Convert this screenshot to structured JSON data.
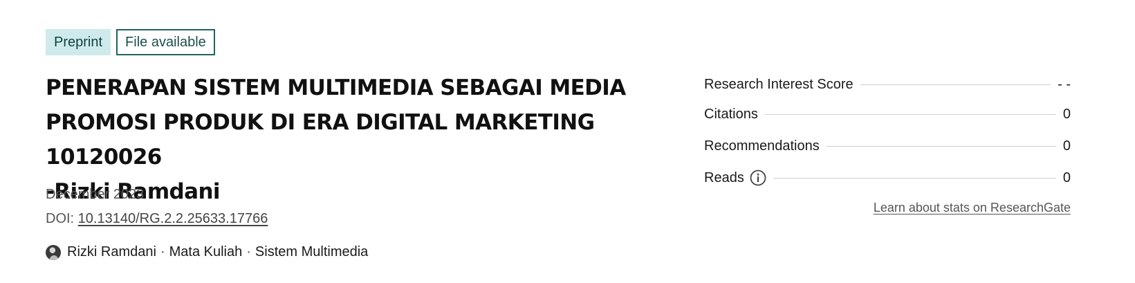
{
  "badges": {
    "preprint": "Preprint",
    "file_available": "File available"
  },
  "title_lines": [
    "PENERAPAN SISTEM MULTIMEDIA SEBAGAI MEDIA",
    "PROMOSI PRODUK DI ERA DIGITAL MARKETING 10120026",
    "-Rizki Ramdani"
  ],
  "date": "December 2023",
  "doi": {
    "label": "DOI: ",
    "value": "10.13140/RG.2.2.25633.17766"
  },
  "authors": {
    "author": "Rizki Ramdani",
    "separator": "·",
    "course": "Mata Kuliah",
    "subject": "Sistem Multimedia"
  },
  "stats": [
    {
      "label": "Research Interest Score",
      "value": "- -"
    },
    {
      "label": "Citations",
      "value": "0"
    },
    {
      "label": "Recommendations",
      "value": "0"
    },
    {
      "label": "Reads",
      "value": "0"
    }
  ],
  "learn_link": "Learn about stats on ResearchGate",
  "colors": {
    "preprint_bg": "#cfeaea",
    "file_border": "#1d6461"
  },
  "icons": {
    "reads_info": "info-icon",
    "avatar": "avatar"
  }
}
